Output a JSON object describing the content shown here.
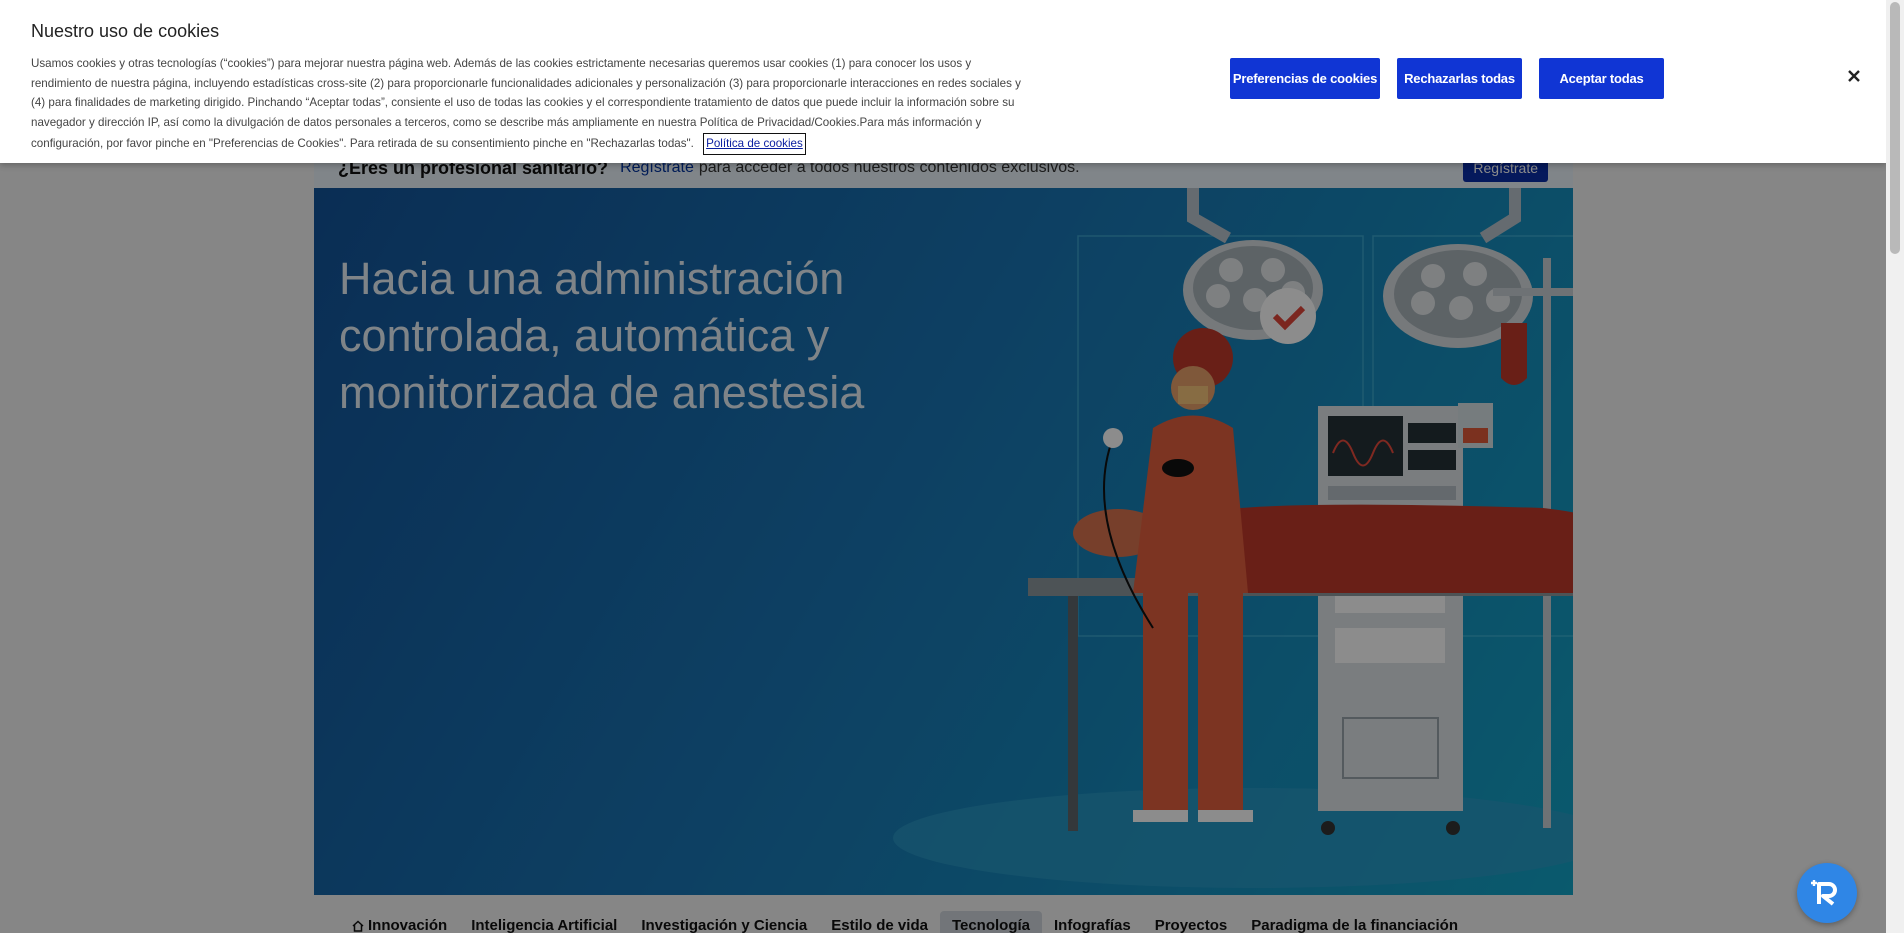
{
  "cookie_banner": {
    "title": "Nuestro uso de cookies",
    "text": "Usamos cookies y otras tecnologías (“cookies”) para mejorar nuestra página web. Además de las cookies estrictamente necesarias queremos usar cookies (1) para conocer los usos y rendimiento de nuestra página, incluyendo estadísticas cross-site (2) para proporcionarle funcionalidades adicionales y personalización (3) para proporcionarle interacciones en redes sociales y (4) para finalidades de marketing dirigido. Pinchando “Aceptar todas”, consiente el uso de todas las cookies y el correspondiente tratamiento de datos que puede incluir la información sobre su navegador y dirección IP, así como la divulgación de datos personales a terceros, como se describe más ampliamente en nuestra Política de Privacidad/Cookies.Para más información y configuración, por favor pinche en \"Preferencias de Cookies\". Para retirada de su consentimiento pinche en \"Rechazarlas todas\".",
    "policy_link": "Política de cookies",
    "btn_preferences": "Preferencias de cookies",
    "btn_reject": "Rechazarlas todas",
    "btn_accept": "Aceptar todas",
    "accent_color": "#1035d4"
  },
  "pro_bar": {
    "question": "¿Eres un profesional sanitario?",
    "link": "Regístrate",
    "text": "para acceder a todos nuestros contenidos exclusivos.",
    "button": "Regístrate"
  },
  "hero": {
    "title": "Hacia una administración controlada, automática y monitorizada de anestesia"
  },
  "categories": [
    {
      "label": "Innovación",
      "icon": "home-icon"
    },
    {
      "label": "Inteligencia Artificial"
    },
    {
      "label": "Investigación y Ciencia"
    },
    {
      "label": "Estilo de vida"
    },
    {
      "label": "Tecnología",
      "active": true
    },
    {
      "label": "Infografías"
    },
    {
      "label": "Proyectos"
    },
    {
      "label": "Paradigma de la financiación"
    }
  ]
}
